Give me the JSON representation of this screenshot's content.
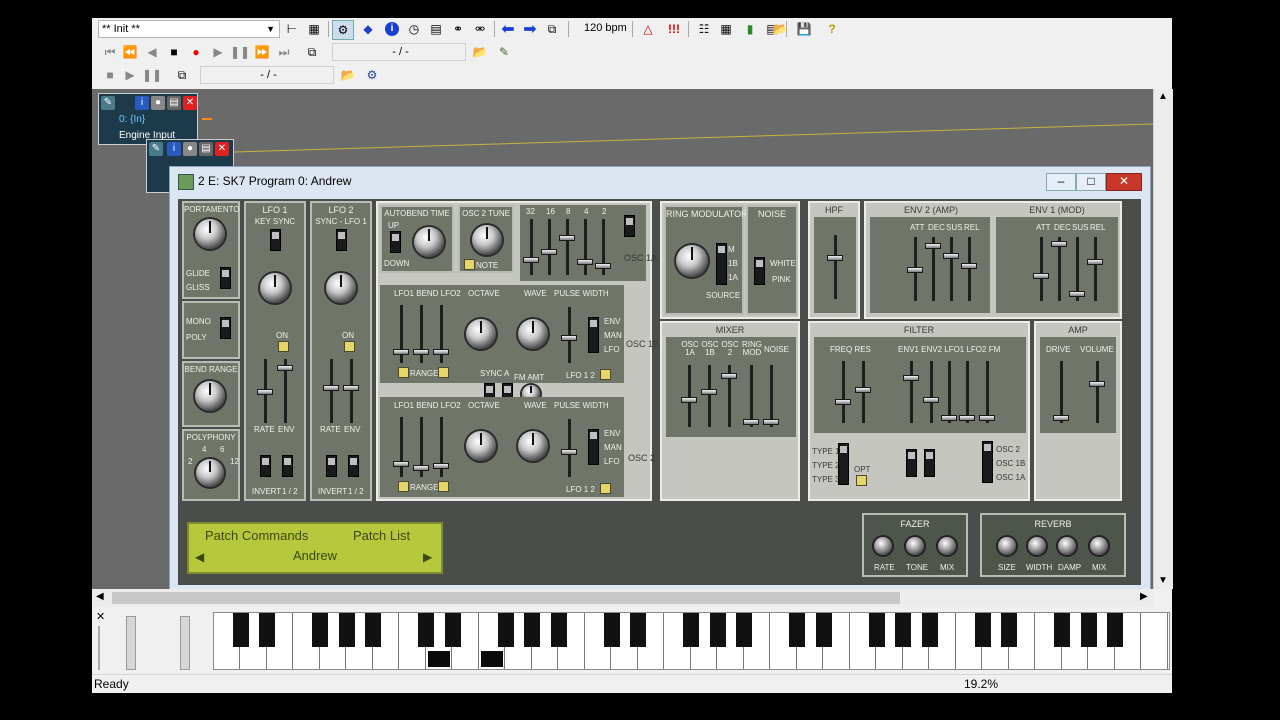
{
  "toolbar": {
    "preset_select": "** Init **",
    "tempo": "120 bpm",
    "transport_position": "- / -",
    "transport_position_2": "- / -"
  },
  "engine_node": {
    "label_top": "0: {In}",
    "label": "Engine Input"
  },
  "synth_window": {
    "title": "2 E: SK7 Program 0: Andrew"
  },
  "synth": {
    "portamento": "PORTAMENTO",
    "glide": "GLIDE",
    "gliss": "GLISS",
    "mono": "MONO",
    "poly": "POLY",
    "bend_range": "BEND RANGE",
    "polyphony": "POLYPHONY",
    "poly_ticks": [
      "4",
      "6",
      "2",
      "12"
    ],
    "lfo1": "LFO 1",
    "lfo2": "LFO 2",
    "key_sync": "KEY SYNC",
    "sync_lfo1": "SYNC - LFO 1",
    "on": "ON",
    "rate": "RATE",
    "env": "ENV",
    "invert": "INVERT",
    "one_two": "1 / 2",
    "autobend_time": "AUTOBEND TIME",
    "up": "UP",
    "down": "DOWN",
    "osc2_tune": "OSC 2 TUNE",
    "note": "NOTE",
    "fader_nums": [
      "32",
      "16",
      "8",
      "4",
      "2"
    ],
    "osc1a": "OSC 1A",
    "osc1b": "OSC 1B",
    "osc2": "OSC 2",
    "lfo_bend": "LFO1 BEND LFO2",
    "octave": "OCTAVE",
    "wave": "WAVE",
    "pulse_width": "PULSE WIDTH",
    "range": "RANGE",
    "env_man_lfo": [
      "ENV",
      "MAN",
      "LFO"
    ],
    "lfo12": "LFO 1 2",
    "sync": "SYNC",
    "a": "A",
    "b": "B",
    "fm_amt": "FM AMT",
    "ring_modulator": "RING MODULATOR",
    "source": "SOURCE",
    "ring_ticks": [
      "M",
      "1B",
      "1A"
    ],
    "noise": "NOISE",
    "white": "WHITE",
    "pink": "PINK",
    "mixer": "MIXER",
    "mixer_labels": [
      "OSC 1A",
      "OSC 1B",
      "OSC 2",
      "RING MOD",
      "NOISE"
    ],
    "hpf": "HPF",
    "env2": "ENV 2 (AMP)",
    "env1": "ENV 1 (MOD)",
    "adsr": [
      "ATT",
      "DEC",
      "SUS",
      "REL"
    ],
    "filter": "FILTER",
    "freq_res": "FREQ RES",
    "filter_mods": "ENV1 ENV2 LFO1 LFO2 FM",
    "types": [
      "TYPE 1",
      "TYPE 2",
      "TYPE 3"
    ],
    "opt": "OPT",
    "osc_routes": [
      "OSC 2",
      "OSC 1B",
      "OSC 1A"
    ],
    "amp": "AMP",
    "drive": "DRIVE",
    "volume": "VOLUME",
    "fazer": "FAZER",
    "fazer_knobs": [
      "RATE",
      "TONE",
      "MIX"
    ],
    "reverb": "REVERB",
    "reverb_knobs": [
      "SIZE",
      "WIDTH",
      "DAMP",
      "MIX"
    ]
  },
  "patch_lcd": {
    "commands": "Patch Commands",
    "list": "Patch List",
    "name": "Andrew"
  },
  "statusbar": {
    "status": "Ready",
    "cpu": "19.2%"
  }
}
